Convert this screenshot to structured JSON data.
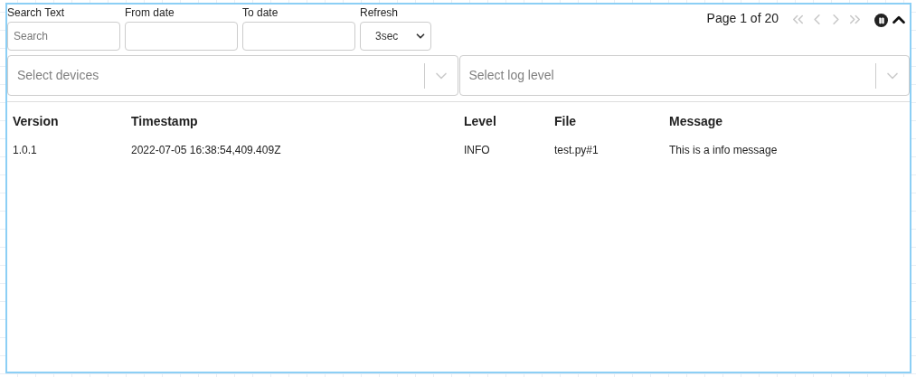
{
  "filters": [
    {
      "kind": "text",
      "label": "Search Text",
      "placeholder": "Search"
    },
    {
      "kind": "date",
      "label": "From date"
    },
    {
      "kind": "date",
      "label": "To date"
    },
    {
      "kind": "select",
      "label": "Refresh",
      "value": "3sec"
    }
  ],
  "pager": {
    "text": "Page 1 of 20",
    "buttons": [
      {
        "kind": "first",
        "disabled": true
      },
      {
        "kind": "prev",
        "disabled": true
      },
      {
        "kind": "next",
        "disabled": true
      },
      {
        "kind": "last",
        "disabled": true
      }
    ],
    "paused": false
  },
  "selects": [
    {
      "placeholder": "Select devices"
    },
    {
      "placeholder": "Select log level"
    }
  ],
  "table": {
    "columns": [
      "Version",
      "Timestamp",
      "Level",
      "File",
      "Message"
    ],
    "rows": [
      [
        "1.0.1",
        "2022-07-05 16:38:54,409.409Z",
        "INFO",
        "test.py#1",
        "This is a info message"
      ]
    ]
  }
}
